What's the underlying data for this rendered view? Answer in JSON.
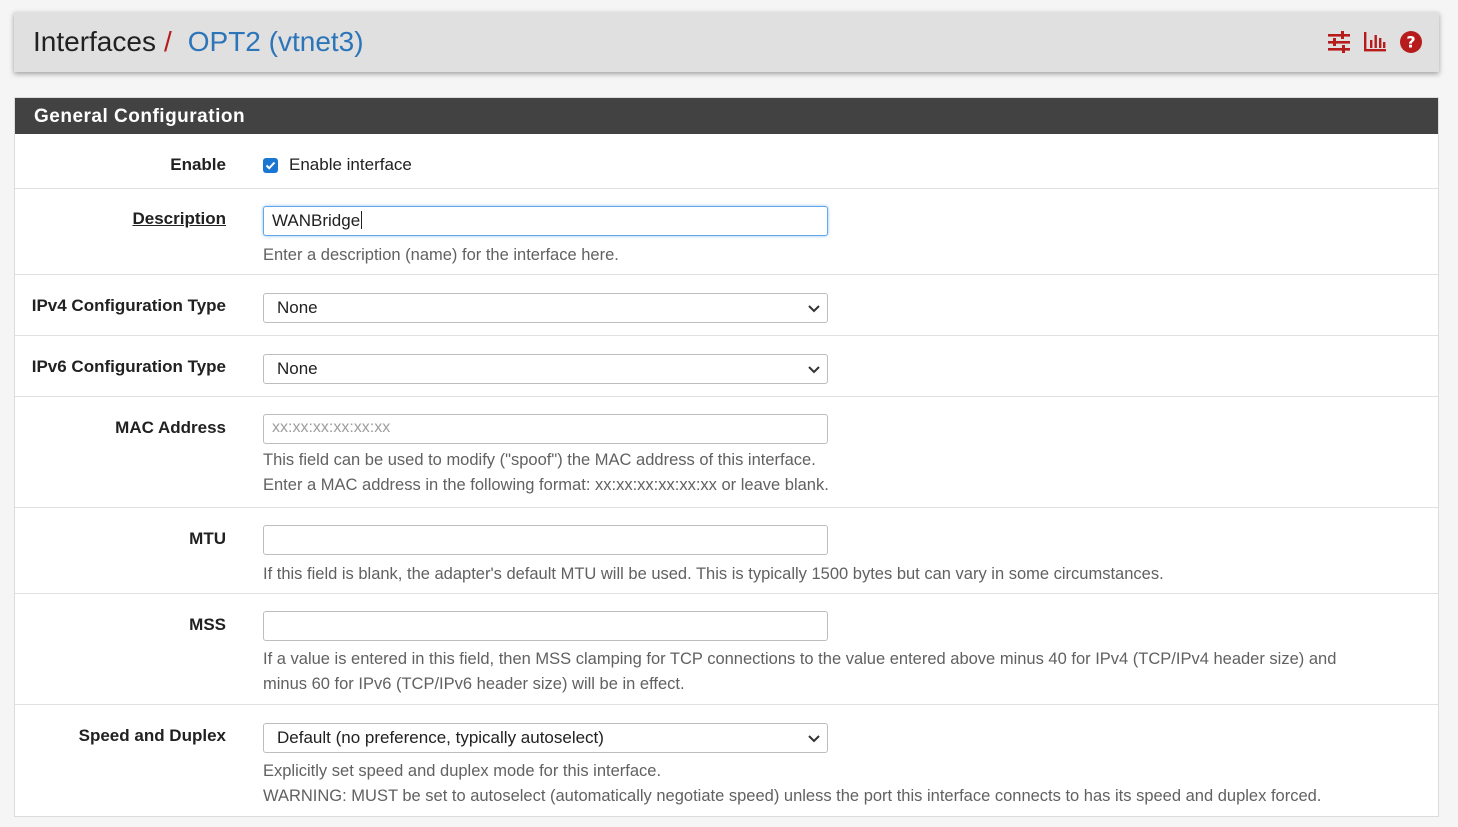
{
  "breadcrumb": {
    "base": "Interfaces",
    "separator": "/",
    "current": "OPT2 (vtnet3)"
  },
  "header_icons": [
    "sliders-icon",
    "bar-chart-icon",
    "help-icon"
  ],
  "panel": {
    "title": "General Configuration"
  },
  "fields": {
    "enable": {
      "label": "Enable",
      "checkbox_label": "Enable interface",
      "checked": true
    },
    "description": {
      "label": "Description",
      "value": "WANBridge",
      "help": "Enter a description (name) for the interface here."
    },
    "ipv4_type": {
      "label": "IPv4 Configuration Type",
      "value": "None"
    },
    "ipv6_type": {
      "label": "IPv6 Configuration Type",
      "value": "None"
    },
    "mac": {
      "label": "MAC Address",
      "placeholder": "xx:xx:xx:xx:xx:xx",
      "help1": "This field can be used to modify (\"spoof\") the MAC address of this interface.",
      "help2": "Enter a MAC address in the following format: xx:xx:xx:xx:xx:xx or leave blank."
    },
    "mtu": {
      "label": "MTU",
      "value": "",
      "help": "If this field is blank, the adapter's default MTU will be used. This is typically 1500 bytes but can vary in some circumstances."
    },
    "mss": {
      "label": "MSS",
      "value": "",
      "help1": "If a value is entered in this field, then MSS clamping for TCP connections to the value entered above minus 40 for IPv4 (TCP/IPv4 header size) and",
      "help2": "minus 60 for IPv6 (TCP/IPv6 header size) will be in effect."
    },
    "speed": {
      "label": "Speed and Duplex",
      "value": "Default (no preference, typically autoselect)",
      "help1": "Explicitly set speed and duplex mode for this interface.",
      "help2": "WARNING: MUST be set to autoselect (automatically negotiate speed) unless the port this interface connects to has its speed and duplex forced."
    }
  },
  "colors": {
    "accent_red": "#b71c1c",
    "link_blue": "#2d75b9",
    "panel_heading": "#424242"
  }
}
